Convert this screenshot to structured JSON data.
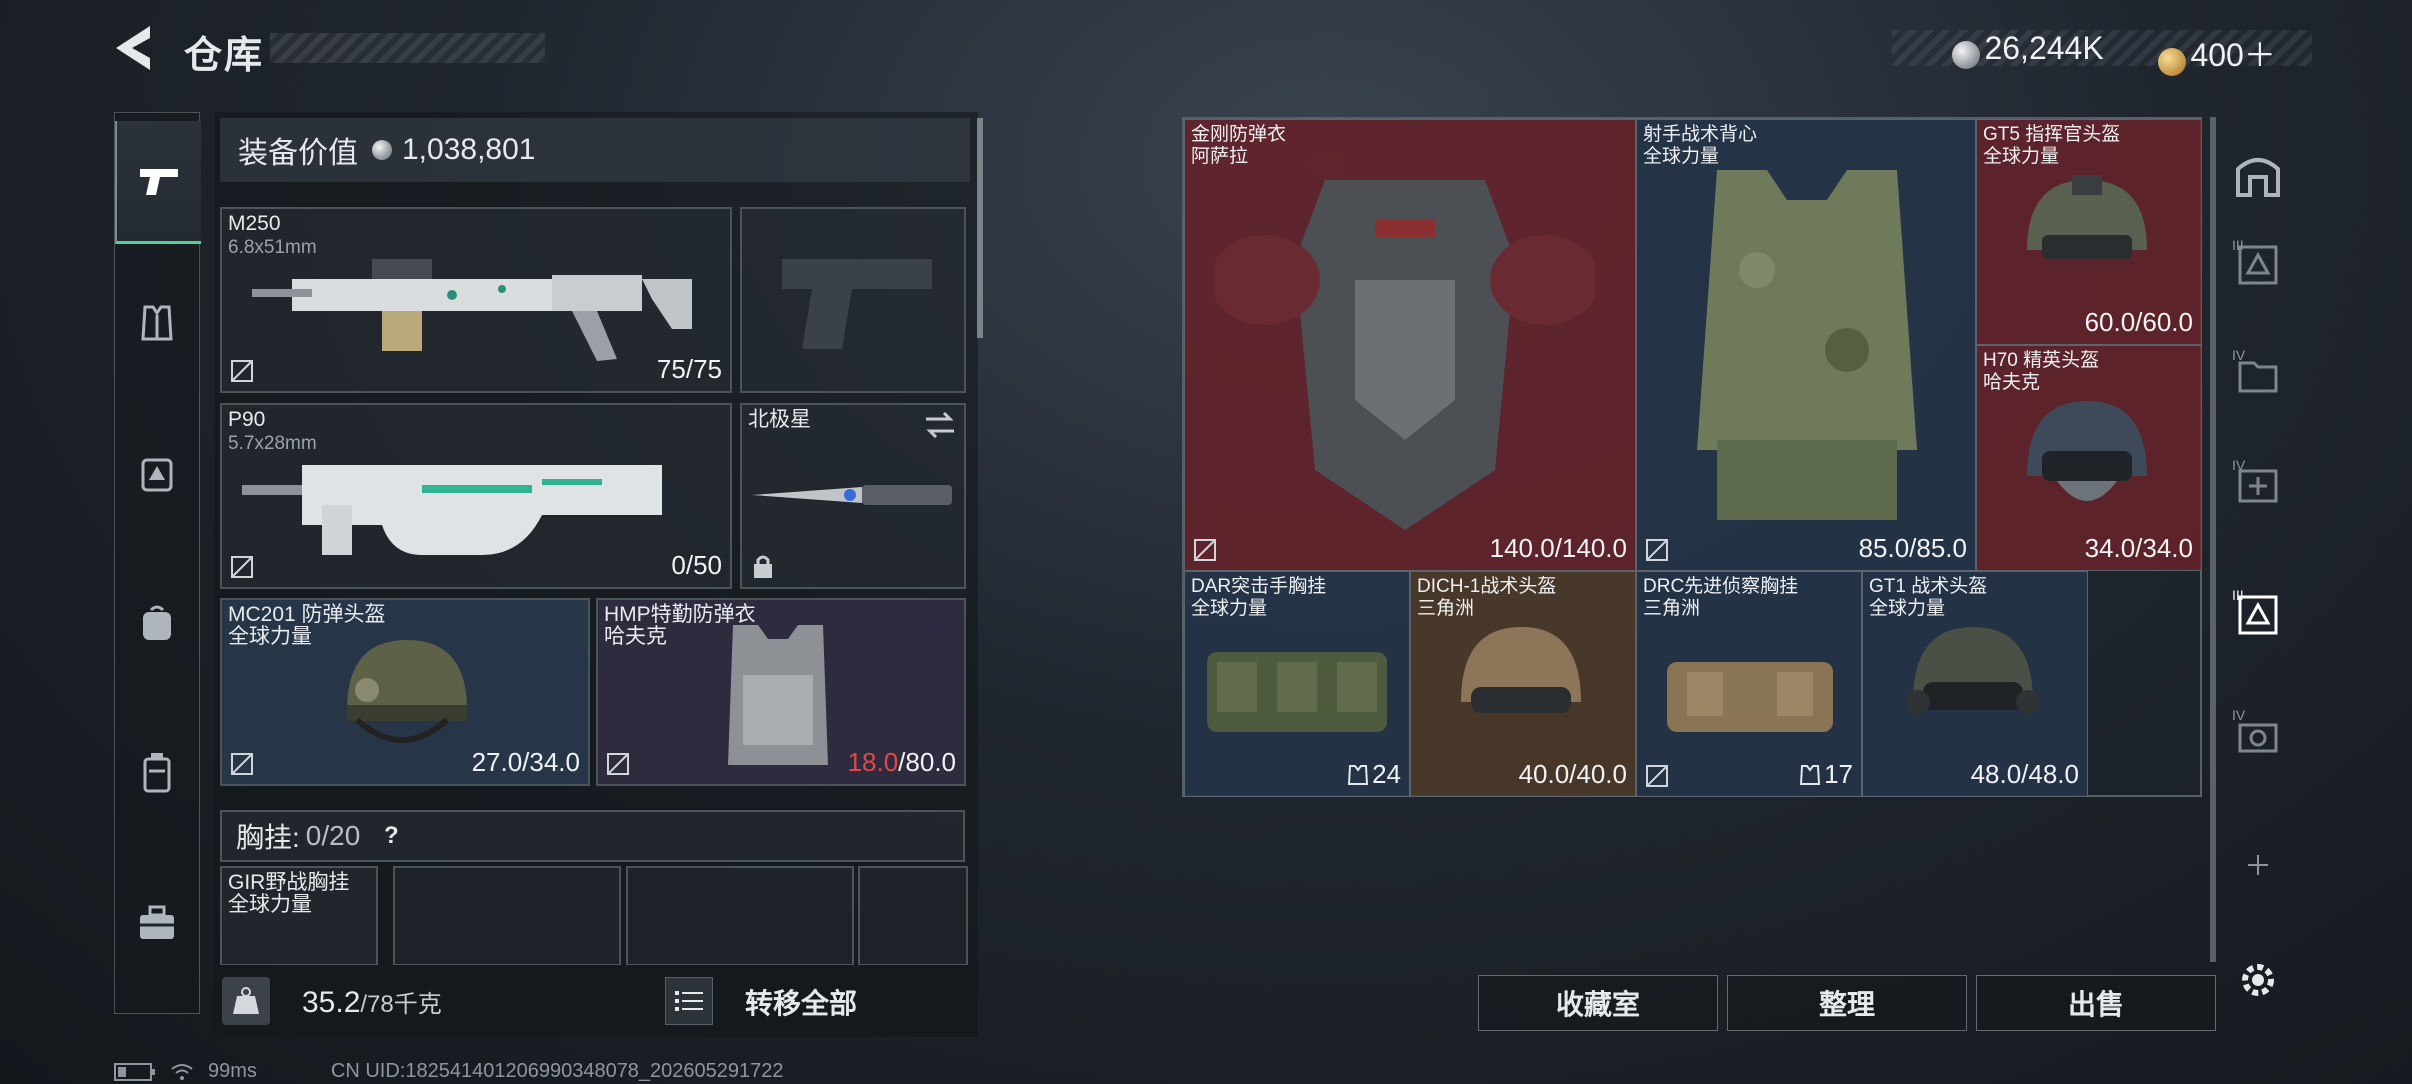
{
  "header": {
    "title": "仓库",
    "currency": [
      {
        "icon": "silver-coin-icon",
        "value": "26,244K"
      },
      {
        "icon": "gold-coin-icon",
        "value": "400＋"
      }
    ]
  },
  "sidebar": {
    "tabs": [
      {
        "name": "weapon",
        "icon": "pistol-icon",
        "active": true
      },
      {
        "name": "vest",
        "icon": "vest-icon"
      },
      {
        "name": "backpack-supply",
        "icon": "backpack-supply-icon"
      },
      {
        "name": "backpack",
        "icon": "backpack-icon"
      },
      {
        "name": "case",
        "icon": "case-icon"
      },
      {
        "name": "toolbox",
        "icon": "toolbox-icon"
      }
    ]
  },
  "loadout": {
    "value_label": "装备价值",
    "value": "1,038,801",
    "primary": {
      "name": "M250",
      "caliber": "6.8x51mm",
      "durability": "75/75"
    },
    "secondary": {
      "name": "P90",
      "caliber": "5.7x28mm",
      "durability": "0/50"
    },
    "melee": {
      "name": "北极星"
    },
    "helmet": {
      "name": "MC201 防弹头盔",
      "brand": "全球力量",
      "durability": "27.0/34.0"
    },
    "armor": {
      "name": "HMP特勤防弹衣",
      "brand": "哈夫克",
      "durability_current": "18.0",
      "durability_max": "/80.0"
    },
    "chest_label": "胸挂:",
    "chest_value": "0/20",
    "chest_item": {
      "name": "GIR野战胸挂",
      "brand": "全球力量"
    },
    "weight": "35.2",
    "weight_unit": "/78千克",
    "transfer_all": "转移全部"
  },
  "storage": {
    "items": [
      {
        "name": "金刚防弹衣",
        "brand": "阿萨拉",
        "durability": "140.0/140.0"
      },
      {
        "name": "射手战术背心",
        "brand": "全球力量",
        "durability": "85.0/85.0"
      },
      {
        "name": "GT5 指挥官头盔",
        "brand": "全球力量",
        "durability": "60.0/60.0"
      },
      {
        "name": "H70 精英头盔",
        "brand": "哈夫克",
        "durability": "34.0/34.0"
      },
      {
        "name": "DAR突击手胸挂",
        "brand": "全球力量",
        "capacity": "24"
      },
      {
        "name": "DICH-1战术头盔",
        "brand": "三角洲",
        "durability": "40.0/40.0"
      },
      {
        "name": "DRC先进侦察胸挂",
        "brand": "三角洲",
        "capacity": "17"
      },
      {
        "name": "GT1 战术头盔",
        "brand": "全球力量",
        "durability": "48.0/48.0"
      }
    ],
    "side_labels": [
      "III",
      "IV",
      "IV",
      "III",
      "IV"
    ],
    "buttons": {
      "collection": "收藏室",
      "organize": "整理",
      "sell": "出售"
    }
  },
  "status_bar": {
    "ping": "99ms",
    "uid": "CN UID:1825414012069903480​78_202605291722"
  },
  "colors": {
    "accent": "#4fd39a",
    "durability_low": "#e04848",
    "rarity_red": "#6e222c",
    "rarity_blue": "#24364a",
    "rarity_brown": "#503c28"
  }
}
